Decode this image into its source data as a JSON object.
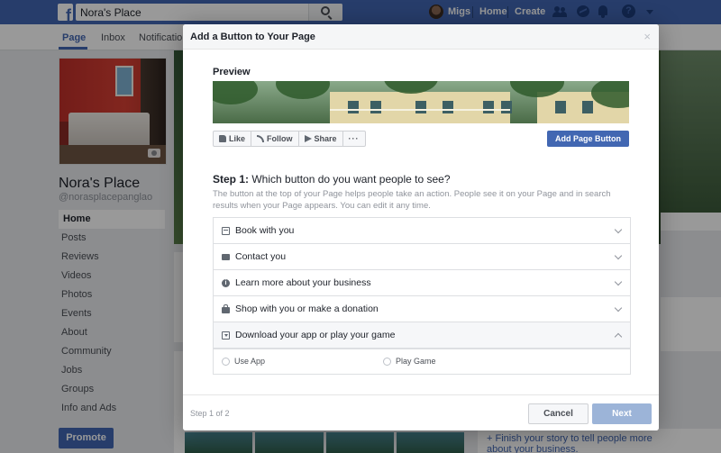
{
  "topbar": {
    "logo": "f",
    "search_value": "Nora's Place",
    "search_placeholder": "Search",
    "user_name": "Migs",
    "home_label": "Home",
    "create_label": "Create",
    "help_glyph": "?",
    "color": "#4267b2"
  },
  "page_tabs": [
    {
      "label": "Page"
    },
    {
      "label": "Inbox"
    },
    {
      "label": "Notificatio"
    }
  ],
  "sidebar": {
    "page_name": "Nora's Place",
    "handle": "@norasplacepanglao",
    "items": [
      {
        "label": "Home"
      },
      {
        "label": "Posts"
      },
      {
        "label": "Reviews"
      },
      {
        "label": "Videos"
      },
      {
        "label": "Photos"
      },
      {
        "label": "Events"
      },
      {
        "label": "About"
      },
      {
        "label": "Community"
      },
      {
        "label": "Jobs"
      },
      {
        "label": "Groups"
      },
      {
        "label": "Info and Ads"
      }
    ],
    "promote_label": "Promote"
  },
  "background": {
    "story_text": "+ Finish your story to tell people more about your business."
  },
  "modal": {
    "title": "Add a Button to Your Page",
    "close_glyph": "×",
    "preview_label": "Preview",
    "preview_actions": [
      "Like",
      "Follow",
      "Share",
      "···"
    ],
    "add_button_label": "Add Page Button",
    "step_label": "Step 1:",
    "step_question": "Which button do you want people to see?",
    "step_description": "The button at the top of your Page helps people take an action. People see it on your Page and in search results when your Page appears. You can edit it any time.",
    "options": [
      {
        "label": "Book with you",
        "icon": "calendar-icon"
      },
      {
        "label": "Contact you",
        "icon": "contact-icon"
      },
      {
        "label": "Learn more about your business",
        "icon": "info-icon"
      },
      {
        "label": "Shop with you or make a donation",
        "icon": "shopping-bag-icon"
      },
      {
        "label": "Download your app or play your game",
        "icon": "download-icon"
      }
    ],
    "info_glyph": "i",
    "sub_options": [
      "Use App",
      "Play Game"
    ],
    "step_count": "Step 1 of 2",
    "cancel_label": "Cancel",
    "next_label": "Next"
  }
}
